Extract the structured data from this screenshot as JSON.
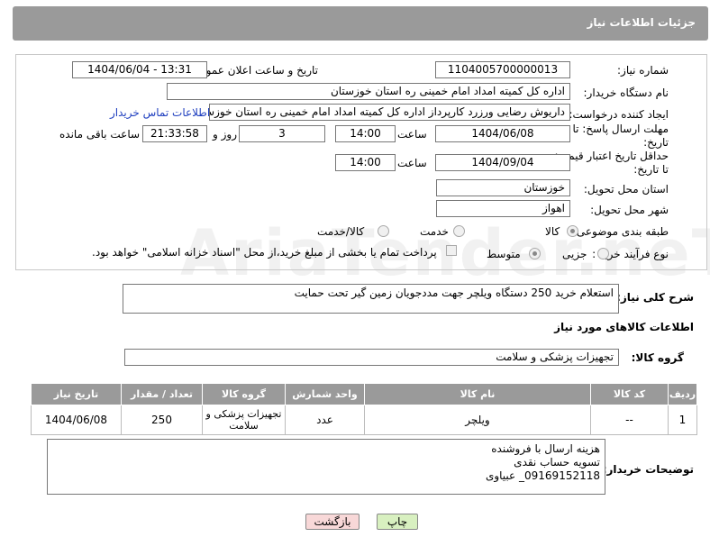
{
  "header": {
    "title": "جزئیات اطلاعات نیاز"
  },
  "form": {
    "need_number_label": "شماره نیاز:",
    "need_number": "1104005700000013",
    "announce_label": "تاریخ و ساعت اعلان عمومی:",
    "announce_value": "1404/06/04 - 13:31",
    "buyer_label": "نام دستگاه خریدار:",
    "buyer_value": "اداره کل کمیته امداد امام خمینی  ره  استان خوزستان",
    "creator_label": "ایجاد کننده درخواست:",
    "creator_value": "داریوش رضایی ورزرد کارپرداز اداره کل کمیته امداد امام خمینی  ره  استان خوزستان",
    "contact_link": "اطلاعات تماس خریدار",
    "deadline_label": "مهلت ارسال پاسخ: تا تاریخ:",
    "deadline_date": "1404/06/08",
    "time_label": "ساعت",
    "deadline_time": "14:00",
    "days": "3",
    "days_label": "روز و",
    "remaining": "21:33:58",
    "remaining_label": "ساعت باقی مانده",
    "validity_label": "حداقل تاریخ اعتبار قیمت: تا تاریخ:",
    "validity_date": "1404/09/04",
    "validity_time_label": "ساعت",
    "validity_time": "14:00",
    "province_label": "استان محل تحویل:",
    "province_value": "خوزستان",
    "city_label": "شهر محل تحویل:",
    "city_value": "اهواز",
    "category_label": "طبقه بندی موضوعی:",
    "category_options": [
      "کالا",
      "خدمت",
      "کالا/خدمت"
    ],
    "process_label": "نوع فرآیند خرید :",
    "process_options": [
      "جزیی",
      "متوسط"
    ],
    "payment_note": "پرداخت تمام یا بخشی از مبلغ خرید،از محل \"اسناد خزانه اسلامی\" خواهد بود."
  },
  "description": {
    "label": "شرح کلی نیاز:",
    "value": "استعلام خرید  250 دستگاه ویلچر جهت مددجویان زمین گیر تحت حمایت"
  },
  "goods": {
    "section_title": "اطلاعات کالاهای مورد نیاز",
    "group_label": "گروه کالا:",
    "group_value": "تجهیزات پزشکی و سلامت"
  },
  "table": {
    "headers": [
      "ردیف",
      "کد کالا",
      "نام کالا",
      "واحد شمارش",
      "گروه کالا",
      "تعداد / مقدار",
      "تاریخ نیاز"
    ],
    "rows": [
      [
        "1",
        "--",
        "ویلچر",
        "عدد",
        "تجهیزات پزشکی و سلامت",
        "250",
        "1404/06/08"
      ]
    ]
  },
  "buyer_notes": {
    "label": "توضیحات خریدار:",
    "lines": [
      "هزینه ارسال با فروشنده",
      "تسویه حساب نقدی",
      "09169152118_ عبیاوی"
    ]
  },
  "buttons": {
    "print": "چاپ",
    "back": "بازگشت"
  },
  "watermark": "AriaTender.neT"
}
